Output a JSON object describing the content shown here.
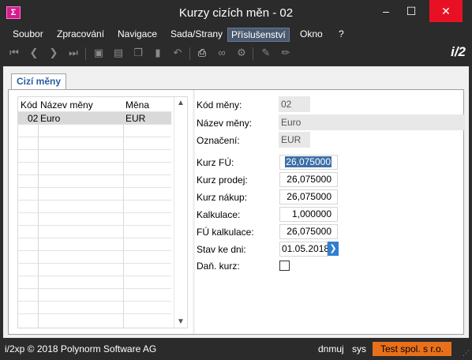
{
  "window": {
    "title": "Kurzy cizích měn - 02",
    "icon_text": "Σ",
    "minimize": "–",
    "maximize": "☐",
    "close": "✕"
  },
  "menu": [
    "Soubor",
    "Zpracování",
    "Navigace",
    "Sada/Strany",
    "Příslušenství",
    "Okno",
    "?"
  ],
  "toolbar": {
    "brand": "i/2",
    "icons": [
      "first-icon",
      "prev-icon",
      "next-icon",
      "last-icon",
      "save-icon",
      "save-copy-icon",
      "copy-icon",
      "delete-icon",
      "undo-icon",
      "print-icon",
      "link-icon",
      "settings-icon",
      "edit-icon",
      "pencil-icon"
    ]
  },
  "tab": {
    "label": "Cizí měny"
  },
  "grid": {
    "columns": [
      "Kód",
      "Název měny",
      "Měna"
    ],
    "rows": [
      {
        "code": "02",
        "name": "Euro",
        "currency": "EUR"
      }
    ]
  },
  "form": {
    "kod_label": "Kód měny:",
    "kod_value": "02",
    "nazev_label": "Název měny:",
    "nazev_value": "Euro",
    "oznaceni_label": "Označení:",
    "oznaceni_value": "EUR",
    "kurz_fu_label": "Kurz FÚ:",
    "kurz_fu_value": "26,075000",
    "kurz_prodej_label": "Kurz prodej:",
    "kurz_prodej_value": "26,075000",
    "kurz_nakup_label": "Kurz nákup:",
    "kurz_nakup_value": "26,075000",
    "kalkulace_label": "Kalkulace:",
    "kalkulace_value": "1,000000",
    "fu_kalkulace_label": "FÚ kalkulace:",
    "fu_kalkulace_value": "26,075000",
    "stav_label": "Stav ke dni:",
    "stav_value": "01.05.2018",
    "dan_label": "Daň. kurz:",
    "dan_checked": false
  },
  "status": {
    "copyright": "i/2xp © 2018 Polynorm Software AG",
    "user": "dnmuj",
    "db": "sys",
    "company": "Test spol. s r.o."
  }
}
